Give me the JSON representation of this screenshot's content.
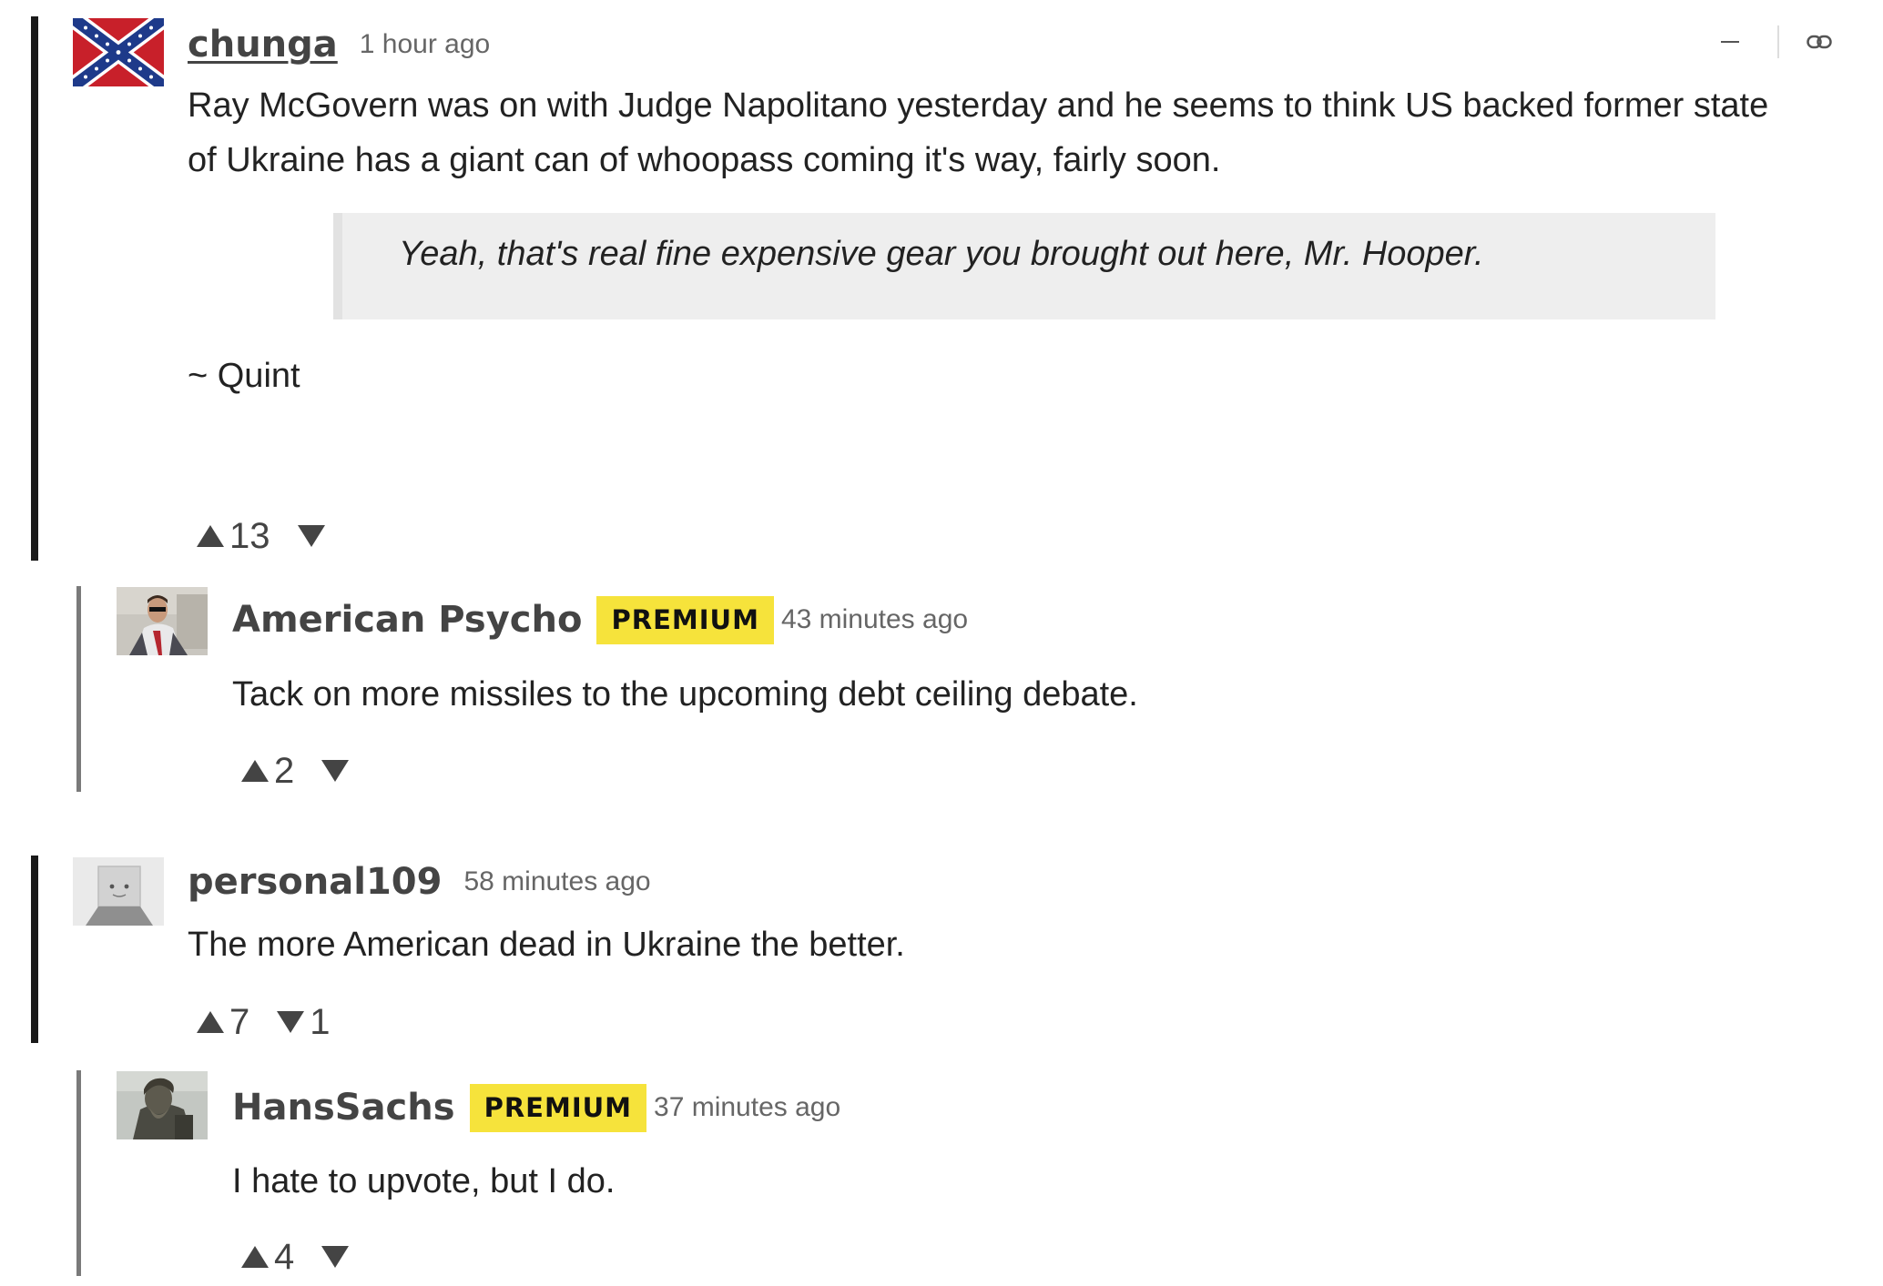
{
  "comments": [
    {
      "username": "chunga",
      "timestamp": "1 hour ago",
      "body_line1": "Ray McGovern was on with Judge Napolitano yesterday and he seems to think US backed former state",
      "body_line2": "of Ukraine has a giant can of whoopass coming it's way, fairly soon.",
      "quote": "Yeah, that's real fine expensive gear you brought out here, Mr. Hooper.",
      "signature": "~ Quint",
      "upvotes": "13",
      "avatar_icon": "confederate-flag-icon",
      "replies": [
        {
          "username": "American Psycho",
          "badge": "PREMIUM",
          "timestamp": "43 minutes ago",
          "body": "Tack on more missiles to the upcoming debt ceiling debate.",
          "upvotes": "2",
          "avatar_icon": "man-in-suit-photo"
        }
      ]
    },
    {
      "username": "personal109",
      "timestamp": "58 minutes ago",
      "body": "The more American dead in Ukraine the better.",
      "upvotes": "7",
      "downvotes": "1",
      "avatar_icon": "paper-bag-figure-photo",
      "replies": [
        {
          "username": "HansSachs",
          "badge": "PREMIUM",
          "timestamp": "37 minutes ago",
          "body": "I hate to upvote, but I do.",
          "upvotes": "4",
          "avatar_icon": "bronze-statue-photo"
        }
      ]
    }
  ],
  "actions": {
    "collapse_icon": "minus-icon",
    "link_icon": "link-icon"
  },
  "colors": {
    "badge": "#f6e33b",
    "thread_bar": "#1a1a1a",
    "reply_bar": "#7a7a7a",
    "quote_bg": "#eeeeee"
  }
}
